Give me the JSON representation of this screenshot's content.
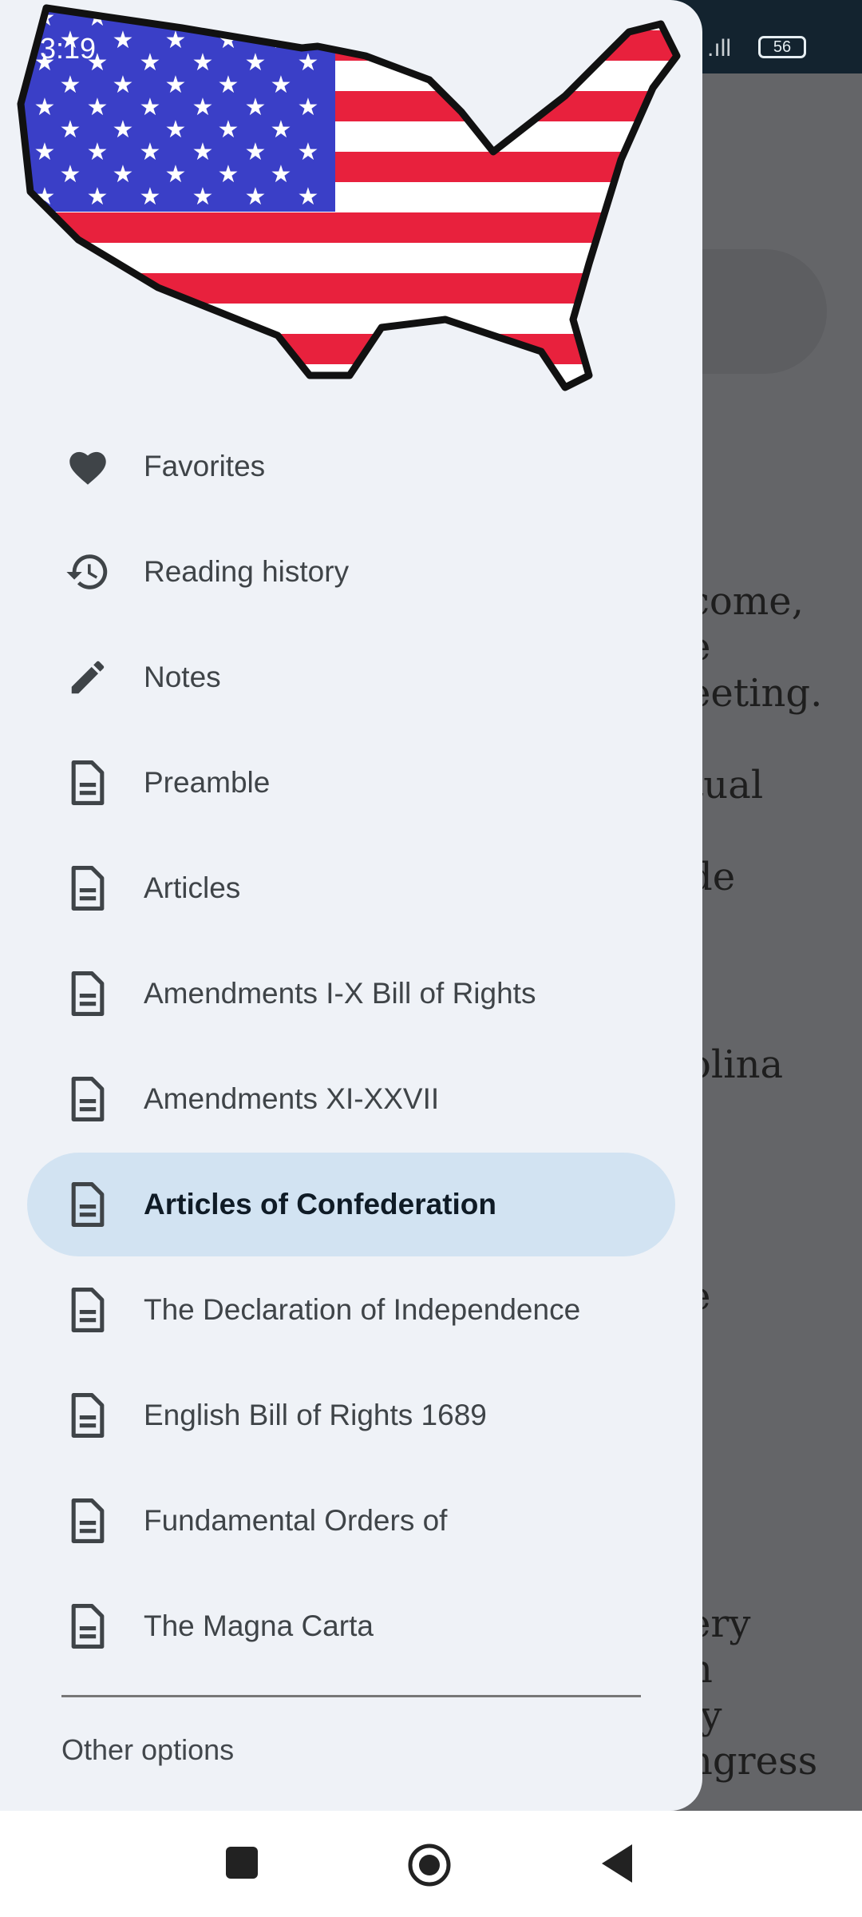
{
  "status_bar": {
    "time": "3:19",
    "signal": ".ıll",
    "battery": "56"
  },
  "background_text": [
    "come,",
    "e",
    "eeting.",
    "tual",
    "de",
    "olina",
    "e",
    "ery",
    "n",
    "ly",
    "ngress"
  ],
  "drawer": {
    "items": [
      {
        "label": "Favorites",
        "icon": "heart-icon"
      },
      {
        "label": "Reading history",
        "icon": "history-icon"
      },
      {
        "label": "Notes",
        "icon": "pencil-icon"
      },
      {
        "label": "Preamble",
        "icon": "document-icon"
      },
      {
        "label": "Articles",
        "icon": "document-icon"
      },
      {
        "label": "Amendments I-X Bill of Rights",
        "icon": "document-icon"
      },
      {
        "label": "Amendments XI-XXVII",
        "icon": "document-icon"
      },
      {
        "label": "Articles of Confederation",
        "icon": "document-icon",
        "selected": true
      },
      {
        "label": "The Declaration of Independence",
        "icon": "document-icon"
      },
      {
        "label": "English Bill of Rights 1689",
        "icon": "document-icon"
      },
      {
        "label": "Fundamental Orders of",
        "icon": "document-icon"
      },
      {
        "label": "The Magna Carta",
        "icon": "document-icon"
      }
    ],
    "other_options": "Other options"
  },
  "colors": {
    "selected_bg": "#d2e3f2",
    "drawer_bg": "#eff2f7",
    "flag_red": "#e8213d",
    "flag_blue": "#3a3fc7"
  }
}
